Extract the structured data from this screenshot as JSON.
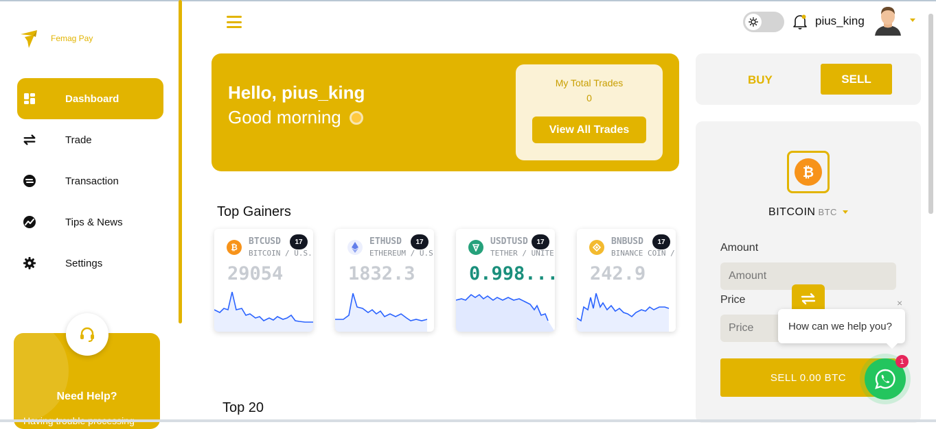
{
  "brand": {
    "name": "Femag Pay"
  },
  "sidebar": {
    "items": [
      {
        "label": "Dashboard",
        "icon": "dashboard-icon",
        "active": true
      },
      {
        "label": "Trade",
        "icon": "swap-arrows-icon",
        "active": false
      },
      {
        "label": "Transaction",
        "icon": "transaction-icon",
        "active": false
      },
      {
        "label": "Tips & News",
        "icon": "chart-trend-icon",
        "active": false
      },
      {
        "label": "Settings",
        "icon": "gear-icon",
        "active": false
      }
    ],
    "help": {
      "title": "Need Help?",
      "subtitle": "Having trouble processing"
    }
  },
  "header": {
    "username": "pius_king",
    "theme": "light"
  },
  "hero": {
    "hello": "Hello, pius_king",
    "greeting": "Good morning",
    "trades_label": "My Total Trades",
    "trades_count": "0",
    "view_button": "View All Trades"
  },
  "sections": {
    "top_gainers": "Top Gainers",
    "top20": "Top 20"
  },
  "tickers": [
    {
      "symbol": "BTCUSD",
      "name": "BITCOIN / U.S. D",
      "price": "29054",
      "up": false,
      "color": "#f7931a"
    },
    {
      "symbol": "ETHUSD",
      "name": "ETHEREUM / U.S",
      "price": "1832.3",
      "up": false,
      "color": "#627eea"
    },
    {
      "symbol": "USDTUSD",
      "name": "TETHER / UNITE",
      "price": "0.998...",
      "up": true,
      "color": "#26a17b"
    },
    {
      "symbol": "BNBUSD",
      "name": "BINANCE COIN /",
      "price": "242.9",
      "up": false,
      "color": "#f3ba2f"
    }
  ],
  "tv_badge": "17",
  "trade_panel": {
    "buy_label": "BUY",
    "sell_label": "SELL",
    "coin_name": "BITCOIN",
    "coin_ticker": "BTC",
    "amount_label": "Amount",
    "amount_placeholder": "Amount",
    "price_label": "Price",
    "price_placeholder": "Price",
    "submit_label": "SELL 0.00 BTC"
  },
  "chat": {
    "prompt": "How can we help you?",
    "badge": "1",
    "close": "×"
  },
  "colors": {
    "accent": "#e2b400",
    "whatsapp": "#23c55e"
  }
}
